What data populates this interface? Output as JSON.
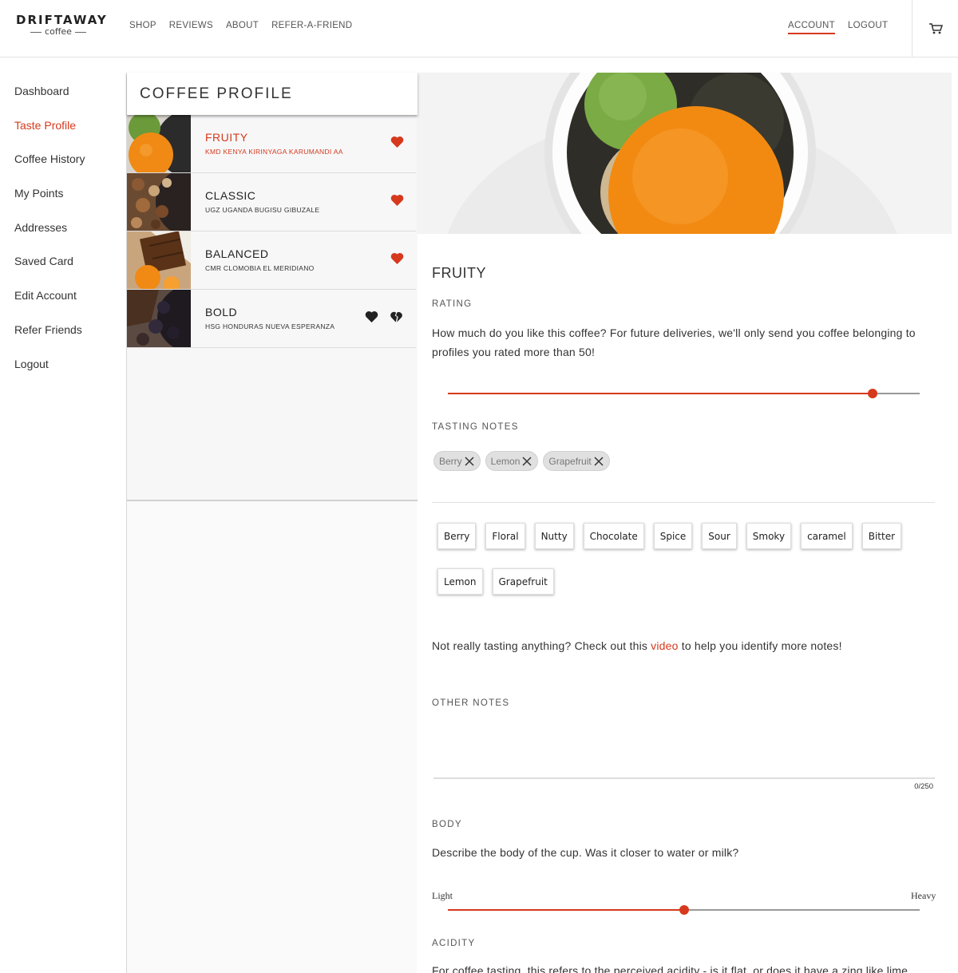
{
  "header": {
    "logo_main": "DRIFTAWAY",
    "logo_sub": "coffee",
    "nav": [
      "SHOP",
      "REVIEWS",
      "ABOUT",
      "REFER-A-FRIEND"
    ],
    "account": "ACCOUNT",
    "logout": "LOGOUT"
  },
  "sidebar": {
    "items": [
      "Dashboard",
      "Taste Profile",
      "Coffee History",
      "My Points",
      "Addresses",
      "Saved Card",
      "Edit Account",
      "Refer Friends",
      "Logout"
    ],
    "active": "Taste Profile"
  },
  "profile": {
    "title": "COFFEE PROFILE",
    "rows": [
      {
        "name": "FRUITY",
        "coffee": "KMD KENYA KIRINYAGA KARUMANDI AA",
        "status": "liked"
      },
      {
        "name": "CLASSIC",
        "coffee": "UGZ UGANDA BUGISU GIBUZALE",
        "status": "liked"
      },
      {
        "name": "BALANCED",
        "coffee": "CMR CLOMOBIA EL MERIDIANO",
        "status": "liked"
      },
      {
        "name": "BOLD",
        "coffee": "HSG HONDURAS NUEVA ESPERANZA",
        "status": "unrated"
      }
    ]
  },
  "detail": {
    "title": "FRUITY",
    "rating_label": "RATING",
    "rating_text": "How much do you like this coffee? For future deliveries, we'll only send you coffee belonging to profiles you rated more than 50!",
    "rating_value": 90,
    "tasting_label": "TASTING NOTES",
    "selected_notes": [
      "Berry",
      "Lemon",
      "Grapefruit"
    ],
    "note_options": [
      "Berry",
      "Floral",
      "Nutty",
      "Chocolate",
      "Spice",
      "Sour",
      "Smoky",
      "caramel",
      "Bitter",
      "Lemon",
      "Grapefruit"
    ],
    "help_before": "Not really tasting anything? Check out this ",
    "help_link": "video",
    "help_after": " to help you identify more notes!",
    "other_label": "OTHER NOTES",
    "other_counter": "0/250",
    "body_label": "BODY",
    "body_text": "Describe the body of the cup. Was it closer to water or milk?",
    "body_low": "Light",
    "body_high": "Heavy",
    "body_value": 50,
    "acidity_label": "ACIDITY",
    "acidity_text": "For coffee tasting, this refers to the perceived acidity - is it flat, or does it have a zing like lime"
  },
  "colors": {
    "accent": "#d6391c"
  }
}
